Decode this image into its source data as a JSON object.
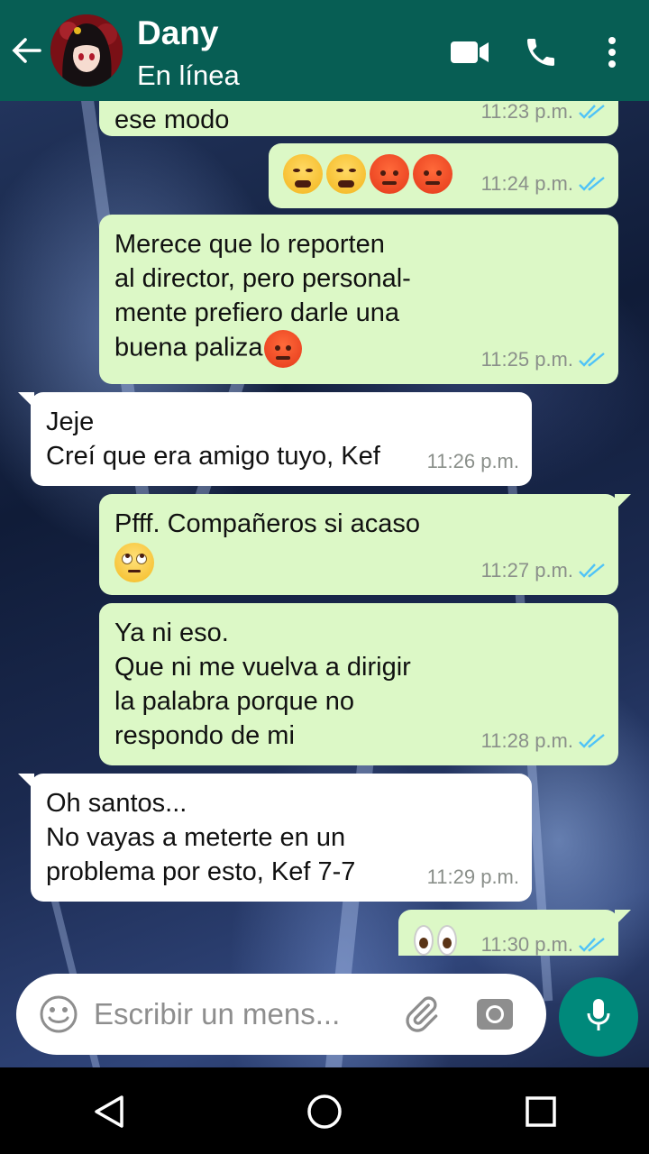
{
  "header": {
    "contact_name": "Dany",
    "status": "En línea",
    "bg_color": "#075e54"
  },
  "messages": [
    {
      "dir": "out",
      "text": "ese modo",
      "time": "11:23 p.m.",
      "read": true
    },
    {
      "dir": "out",
      "emoji": [
        "face-with-steam",
        "face-with-steam",
        "angry-face",
        "angry-face"
      ],
      "time": "11:24 p.m.",
      "read": true
    },
    {
      "dir": "out",
      "text": "Merece que lo reporten\nal director, pero personal-\nmente prefiero darle una\nbuena paliza",
      "emoji": [
        "angry-face"
      ],
      "time": "11:25 p.m.",
      "read": true
    },
    {
      "dir": "in",
      "text": "Jeje\nCreí que era amigo tuyo, Kef",
      "time": "11:26 p.m."
    },
    {
      "dir": "out",
      "text": "Pfff. Compañeros si acaso",
      "emoji": [
        "eye-roll-face"
      ],
      "time": "11:27 p.m.",
      "read": true
    },
    {
      "dir": "out",
      "text": "Ya ni eso.\nQue ni me vuelva a dirigir\nla palabra porque no\nrespondo de mi",
      "time": "11:28 p.m.",
      "read": true
    },
    {
      "dir": "in",
      "text": "Oh santos...\nNo vayas a meterte en un\nproblema por esto, Kef 7-7",
      "time": "11:29 p.m."
    },
    {
      "dir": "out",
      "emoji": [
        "eyes"
      ],
      "time": "11:30 p.m.",
      "read": true
    }
  ],
  "composer": {
    "placeholder": "Escribir un mens..."
  },
  "colors": {
    "outgoing_bubble": "#dcf8c6",
    "incoming_bubble": "#ffffff",
    "read_tick": "#4fc3f7",
    "mic_button": "#00897b"
  }
}
